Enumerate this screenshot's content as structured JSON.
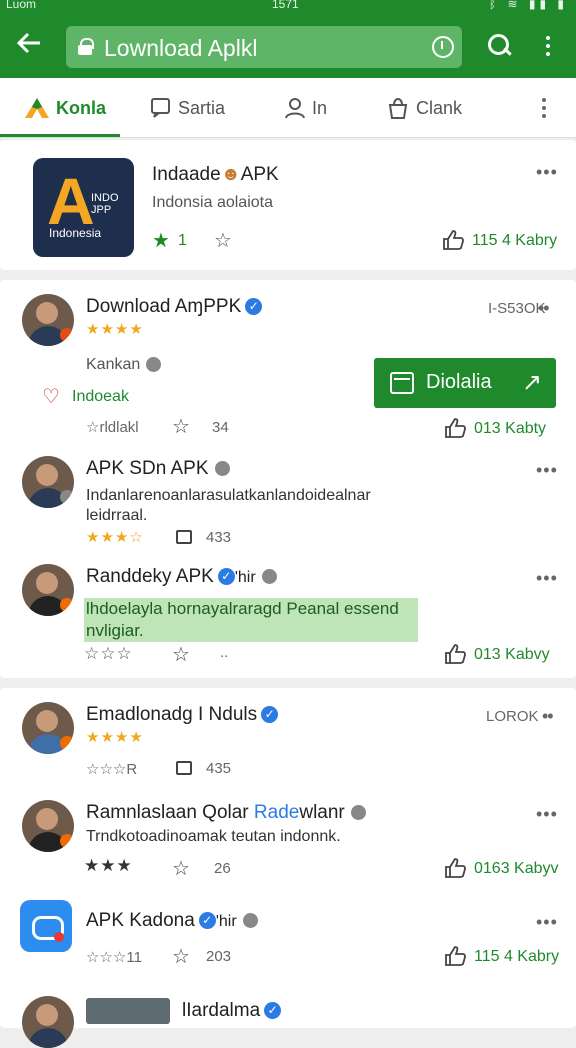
{
  "status": {
    "left": "Luom",
    "time": "1571",
    "right": "ᛒ ≋ ▮▮ ▮"
  },
  "browser": {
    "url": "Lownload Aplkl"
  },
  "tabs": [
    {
      "label": "Konla",
      "active": true
    },
    {
      "label": "Sartia",
      "active": false
    },
    {
      "label": "In",
      "active": false
    },
    {
      "label": "Clank",
      "active": false
    }
  ],
  "app": {
    "name": "Indaade",
    "name_suffix": "APK",
    "subtitle": "Indonsia  aolaiota",
    "rating": "1",
    "likes": "115 4 Kabry",
    "icon_text": "Indonesia",
    "icon_tag": "INDO JPP"
  },
  "comments": [
    {
      "name": "Download AɱPPK",
      "stars": "★★★★",
      "meta": "I-S53OK",
      "tag": "Kankan",
      "fav": "Indoeak",
      "stars_out": "☆rldlakl",
      "count": "34",
      "likes": "013 Kabty",
      "button": "Diolalia"
    },
    {
      "name": "APK SDn APK",
      "body": "Indanlarenoanlarasulatkanlandoidealnar leidrraal.",
      "stars": "★★★☆",
      "count": "433"
    },
    {
      "name": "Randdeky APK",
      "suffix": "'hir",
      "body": "lhdoelayla hornayalraragd Peanal essend nvligiar.",
      "stars_out": "☆☆☆",
      "count": "..",
      "likes": "013 Kabvy"
    },
    {
      "name": "Emadlonadg I Nduls",
      "meta": "LOROK",
      "stars": "★★★★",
      "stars_out": "☆☆☆R",
      "count": "435"
    },
    {
      "name": "Ramnlaslaan Qolar",
      "name_blue": "Rade",
      "name_rest": "wlanr",
      "body": "Trndkotoadinoamak teutan indonnk.",
      "stars": "★★★",
      "count": "26",
      "likes": "0163 Kabyv"
    },
    {
      "name": "APK Kadona",
      "suffix": "'hir",
      "stars_out": "☆☆☆11",
      "count": "203",
      "likes": "115 4 Kabry"
    },
    {
      "name": "lIardalma"
    }
  ],
  "colors": {
    "brand": "#1f8a2c",
    "verified": "#2c7be5",
    "highlight": "#bfe4b7"
  }
}
